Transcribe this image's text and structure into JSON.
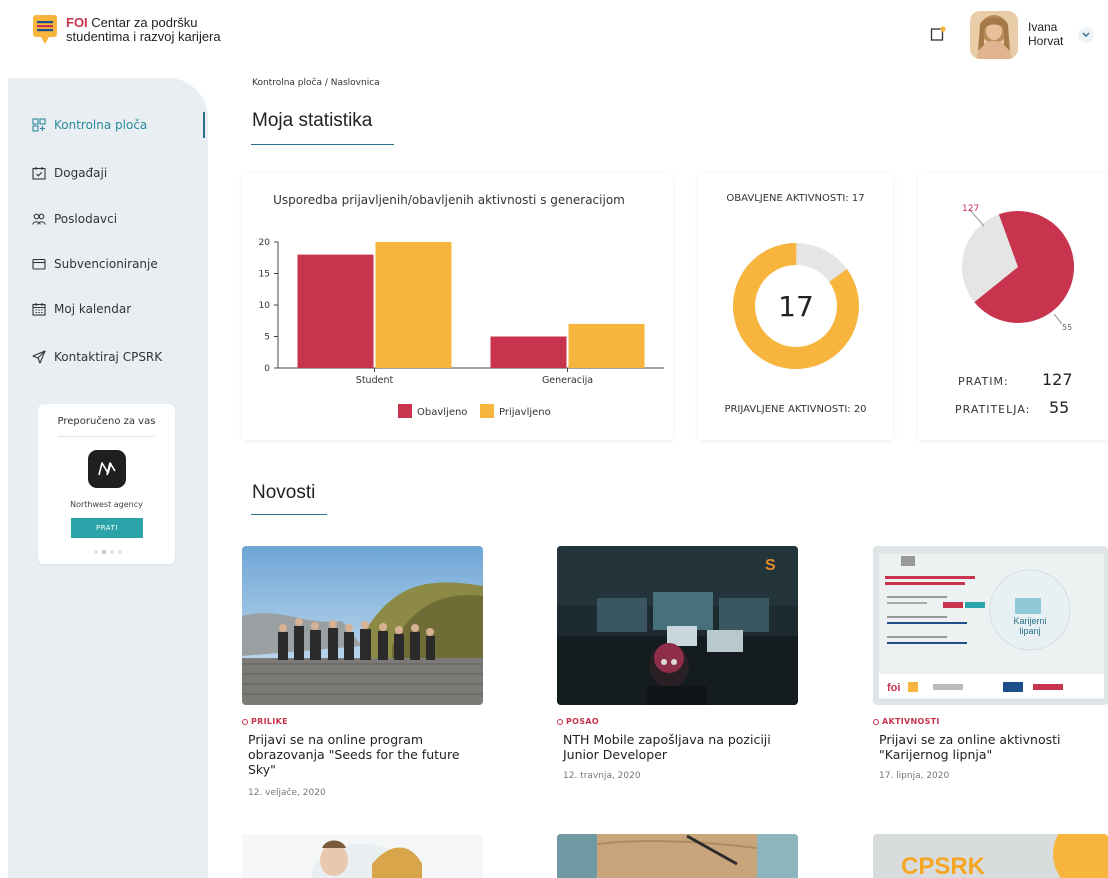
{
  "header": {
    "logo_brand": "FOI",
    "logo_line1": " Centar za podršku",
    "logo_line2": "studentima i razvoj karijera",
    "user_first": "Ivana",
    "user_last": "Horvat"
  },
  "sidebar": {
    "items": [
      {
        "label": "Kontrolna ploča",
        "icon": "dashboard-icon"
      },
      {
        "label": "Događaji",
        "icon": "calendar-check-icon"
      },
      {
        "label": "Poslodavci",
        "icon": "users-icon"
      },
      {
        "label": "Subvencioniranje",
        "icon": "card-icon"
      },
      {
        "label": "Moj kalendar",
        "icon": "calendar-icon"
      },
      {
        "label": "Kontaktiraj CPSRK",
        "icon": "send-icon"
      }
    ],
    "recommend": {
      "title": "Preporučeno za vas",
      "company": "Northwest agency",
      "button": "PRATI"
    }
  },
  "breadcrumb": "Kontrolna ploča / Naslovnica",
  "stats_title": "Moja statistika",
  "news_title": "Novosti",
  "chart_data": {
    "type": "bar",
    "title": "Usporedba prijavljenih/obavljenih aktivnosti s generacijom",
    "categories": [
      "Student",
      "Generacija"
    ],
    "series": [
      {
        "name": "Obavljeno",
        "values": [
          18,
          5
        ],
        "color": "#c8344e"
      },
      {
        "name": "Prijavljeno",
        "values": [
          20,
          7
        ],
        "color": "#f7b53e"
      }
    ],
    "yticks": [
      0,
      5,
      10,
      15,
      20
    ],
    "ylim": [
      0,
      20
    ],
    "legend": "bottom"
  },
  "donut": {
    "top_label": "OBAVLJENE AKTIVNOSTI: 17",
    "bottom_label": "PRIJAVLJENE AKTIVNOSTI: 20",
    "center": "17",
    "done": 17,
    "total": 20,
    "color": "#f7b53e",
    "rest_color": "#e5e5e5"
  },
  "follow": {
    "pratim_label": "PRATIM:",
    "pratim_value": "127",
    "pratitelja_label": "PRATITELJA:",
    "pratitelja_value": "55",
    "pie_label_a": "127",
    "pie_label_b": "55",
    "a": 127,
    "b": 55,
    "color_a": "#c8344e",
    "color_b": "#e5e5e5"
  },
  "news": [
    {
      "tag": "PRILIKE",
      "title": "Prijavi se na online program obrazovanja \"Seeds for the future Sky\"",
      "date": "12. veljače, 2020"
    },
    {
      "tag": "POSAO",
      "title": "NTH Mobile zapošljava na poziciji Junior Developer",
      "date": "12. travnja, 2020"
    },
    {
      "tag": "AKTIVNOSTI",
      "title": "Prijavi se za online aktivnosti \"Karijernog lipnja\"",
      "date": "17. lipnja, 2020"
    }
  ],
  "bottom_card3_text": "CPSRK"
}
